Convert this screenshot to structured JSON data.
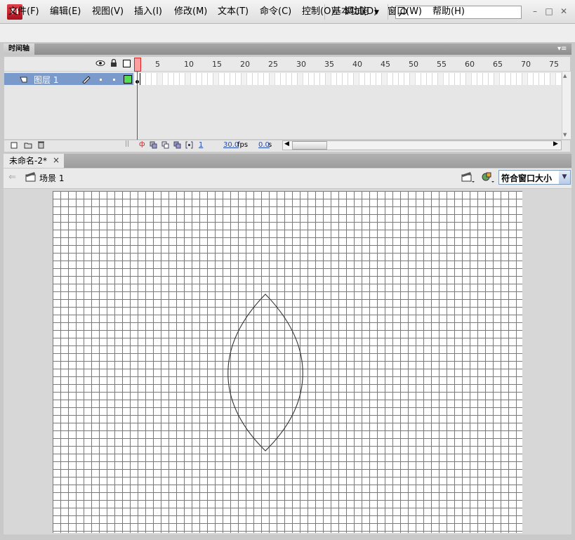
{
  "app": {
    "logo": "Fl",
    "workspace": "基本功能"
  },
  "window_controls": {
    "minimize": "–",
    "maximize": "□",
    "close": "✕"
  },
  "menus": [
    "文件(F)",
    "编辑(E)",
    "视图(V)",
    "插入(I)",
    "修改(M)",
    "文本(T)",
    "命令(C)",
    "控制(O)",
    "调试(D)",
    "窗口(W)",
    "帮助(H)"
  ],
  "timeline": {
    "tab_label": "时间轴",
    "layer_name": "图层 1",
    "ruler_numbers": [
      "5",
      "10",
      "15",
      "20",
      "25",
      "30",
      "35",
      "40",
      "45",
      "50",
      "55",
      "60",
      "65",
      "70",
      "75"
    ],
    "current_frame": "1",
    "fps": "30.0",
    "fps_unit": "fps",
    "time": "0.0",
    "time_unit": "s"
  },
  "document": {
    "tab_label": "未命名-2*",
    "close": "×"
  },
  "editbar": {
    "scene_label": "场景 1",
    "zoom_value": "符合窗口大小"
  },
  "stage": {
    "shape": "leaf-outline",
    "shape_color": "#333333",
    "grid_color": "#7a7a7a"
  },
  "colors": {
    "layer_highlight": "#7b9acc",
    "playhead": "#e02020",
    "outline_box": "#55dd55"
  }
}
